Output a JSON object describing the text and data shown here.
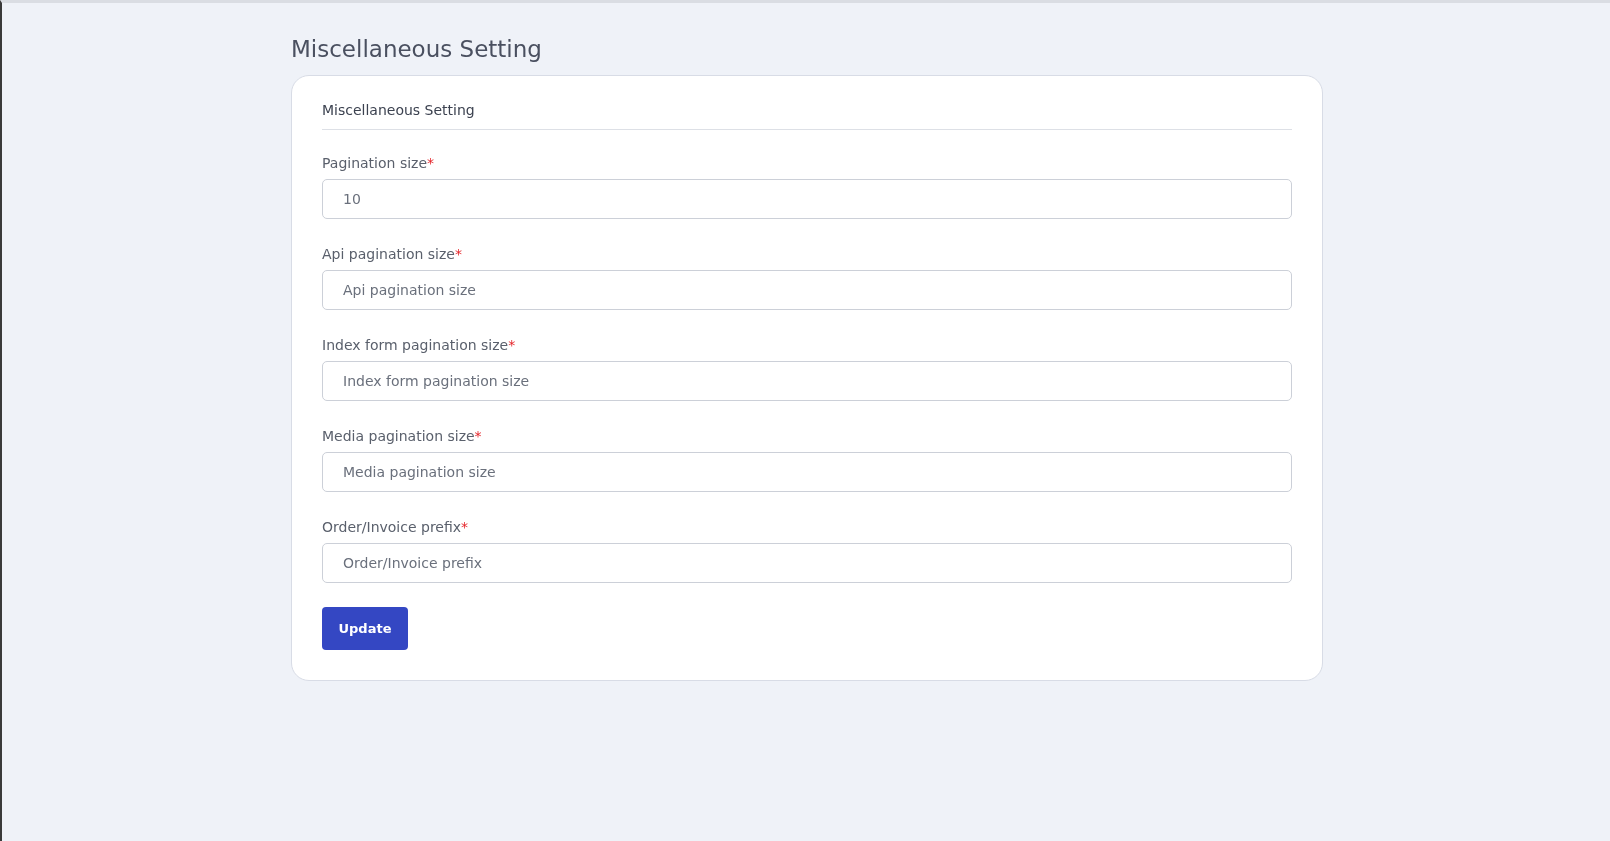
{
  "page_title": "Miscellaneous Setting",
  "card": {
    "title": "Miscellaneous Setting",
    "fields": [
      {
        "label": "Pagination size",
        "required_mark": "*",
        "value": "10"
      },
      {
        "label": "Api pagination size",
        "required_mark": "*",
        "placeholder": "Api pagination size"
      },
      {
        "label": "Index form pagination size",
        "required_mark": "*",
        "placeholder": "Index form pagination size"
      },
      {
        "label": "Media pagination size",
        "required_mark": "*",
        "placeholder": "Media pagination size"
      },
      {
        "label": "Order/Invoice prefix",
        "required_mark": "*",
        "placeholder": "Order/Invoice prefix"
      }
    ],
    "button": "Update"
  }
}
